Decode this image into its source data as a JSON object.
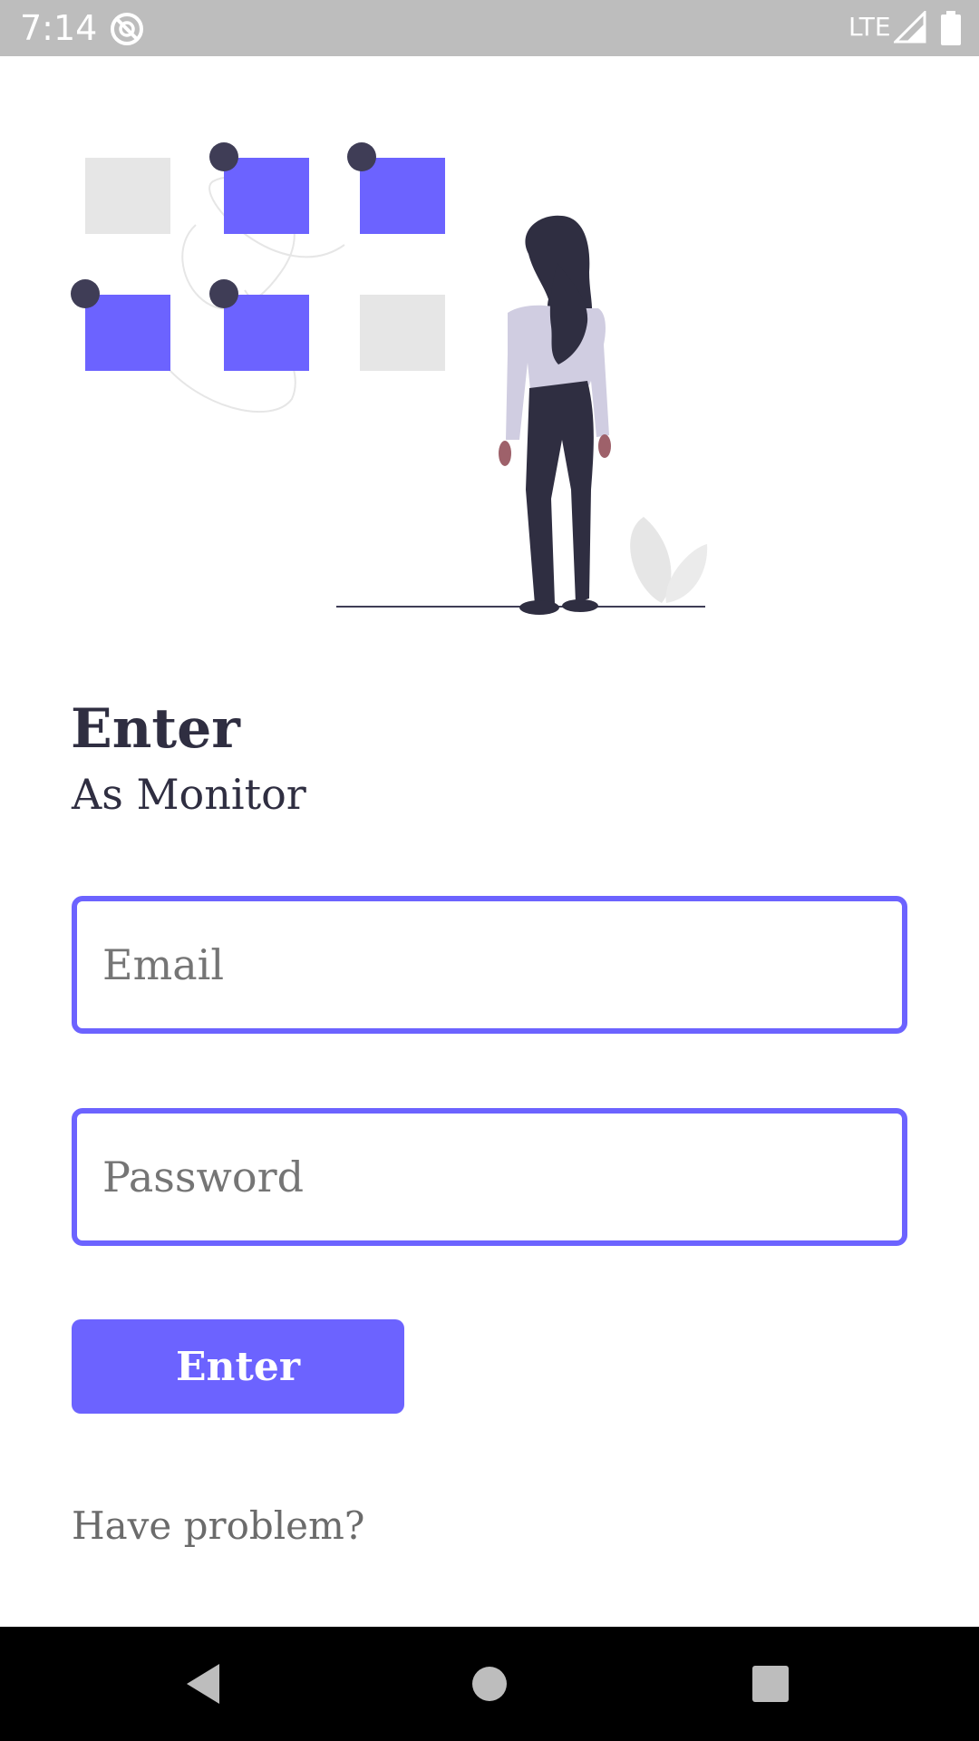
{
  "status_bar": {
    "time": "7:14",
    "network": "LTE",
    "app_icon": "notification-app-icon",
    "signal_icon": "cell-signal-icon",
    "battery_icon": "battery-icon"
  },
  "illustration": {
    "icon": "woman-looking-at-grid-illustration",
    "colors": {
      "accent": "#6c63ff",
      "dark": "#3f3d56",
      "light_block": "#e6e6e6"
    }
  },
  "header": {
    "title": "Enter",
    "subtitle": "As Monitor"
  },
  "form": {
    "email_placeholder": "Email",
    "email_value": "",
    "password_placeholder": "Password",
    "password_value": "",
    "submit_label": "Enter",
    "help_link": "Have problem?"
  },
  "nav_bar": {
    "back_icon": "back-triangle-icon",
    "home_icon": "home-circle-icon",
    "recents_icon": "recents-square-icon"
  },
  "colors": {
    "accent": "#6c63ff",
    "text_dark": "#2f2e41",
    "text_muted": "#6b6b6b",
    "status_bar": "#bdbdbd",
    "nav_bar": "#000000"
  }
}
